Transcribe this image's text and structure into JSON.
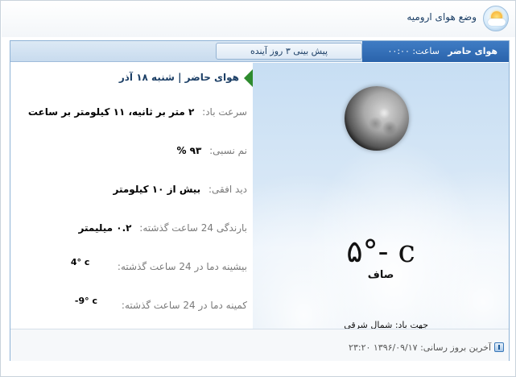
{
  "window": {
    "title": "وضع هوای ارومیه",
    "icon": "weather-sun-cloud-icon"
  },
  "tabs": {
    "current_label": "هوای حاضر",
    "time_label": "ساعت: ۰۰:۰۰",
    "forecast_label": "پیش بینی ۳ روز آینده"
  },
  "current": {
    "header": "هوای حاضر | شنبه ۱۸ آذر",
    "icon": "moon-icon",
    "temperature": "۵°- c",
    "condition": "صاف",
    "wind_direction": "جهت باد: شمال شرقی"
  },
  "details": {
    "wind_speed_label": "سرعت باد:",
    "wind_speed_value": "۲ متر بر ثانیه، ۱۱ کیلومتر بر ساعت",
    "humidity_label": "نم نسبی:",
    "humidity_value": "۹۳ %",
    "visibility_label": "دید افقی:",
    "visibility_value": "بیش از ۱۰ کیلومتر",
    "rain_label": "بارندگی 24 ساعت گذشته:",
    "rain_value": "۰.۲ میلیمتر",
    "max_temp_label": "بیشینه دما در 24 ساعت گذشته:",
    "max_temp_value": "4° c",
    "min_temp_label": "کمینه دما در 24 ساعت گذشته:",
    "min_temp_value": "-9° c"
  },
  "footer": {
    "last_update": "آخرین بروز رسانی: ۱۳۹۶/۰۹/۱۷ ۲۳:۲۰",
    "icon": "info-icon"
  },
  "colors": {
    "tab_active": "#2a63ab",
    "header_text": "#1c3f66",
    "arrow": "#2e8b2e"
  }
}
